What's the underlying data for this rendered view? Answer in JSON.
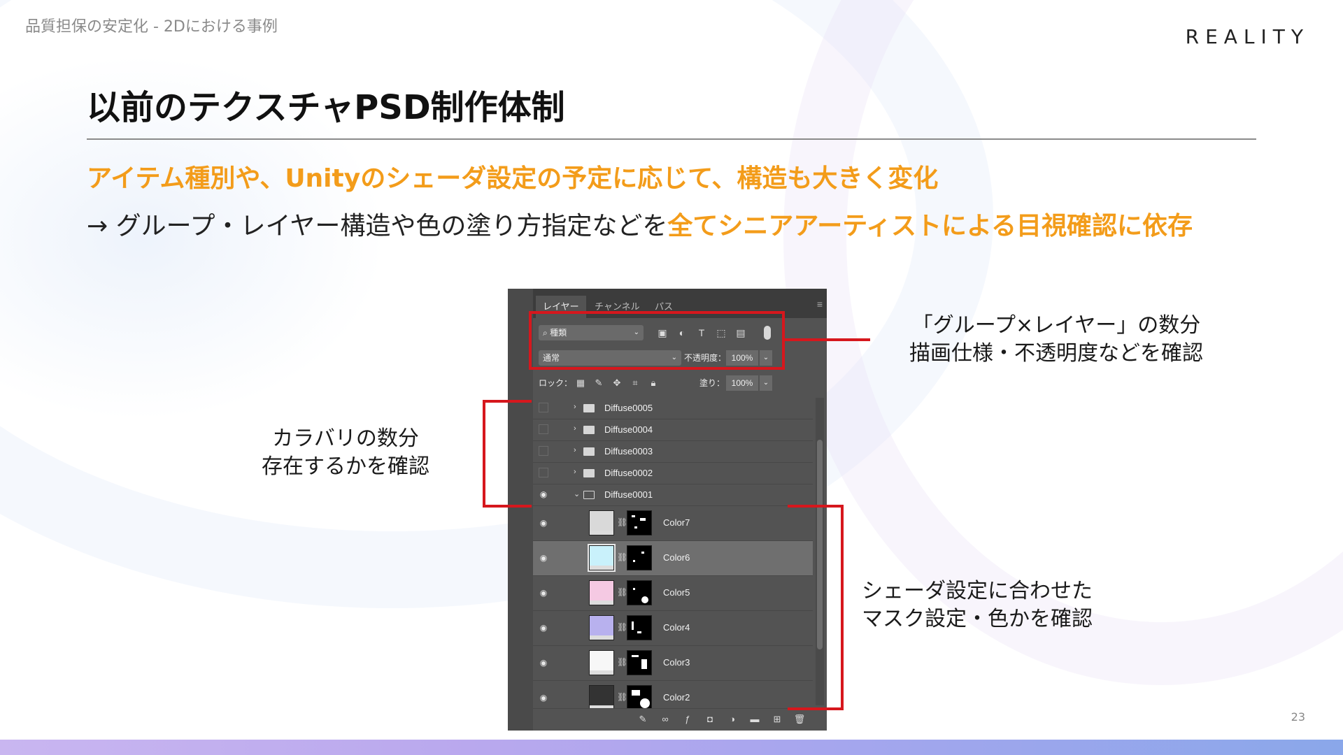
{
  "header": {
    "topic": "品質担保の安定化 - 2Dにおける事例",
    "logo": "REALITY"
  },
  "slide": {
    "title": "以前のテクスチャPSD制作体制",
    "line1": "アイテム種別や、Unityのシェーダ設定の予定に応じて、構造も大きく変化",
    "line2_prefix": "→ グループ・レイヤー構造や色の塗り方指定などを",
    "line2_highlight": "全てシニアアーティストによる目視確認に依存",
    "page_number": "23"
  },
  "annotations": {
    "top_right": [
      "「グループ×レイヤー」の数分",
      "描画仕様・不透明度などを確認"
    ],
    "left": [
      "カラバリの数分",
      "存在するかを確認"
    ],
    "bottom_right": [
      "シェーダ設定に合わせた",
      "マスク設定・色かを確認"
    ]
  },
  "panel": {
    "tabs": [
      "レイヤー",
      "チャンネル",
      "パス"
    ],
    "active_tab": "レイヤー",
    "filter_kind": "種類",
    "blend_mode": "通常",
    "opacity_label": "不透明度：",
    "opacity_value": "100%",
    "lock_label": "ロック：",
    "fill_label": "塗り：",
    "fill_value": "100%",
    "groups": [
      {
        "name": "Diffuse0005",
        "visible": false,
        "expanded": false
      },
      {
        "name": "Diffuse0004",
        "visible": false,
        "expanded": false
      },
      {
        "name": "Diffuse0003",
        "visible": false,
        "expanded": false
      },
      {
        "name": "Diffuse0002",
        "visible": false,
        "expanded": false
      },
      {
        "name": "Diffuse0001",
        "visible": true,
        "expanded": true
      }
    ],
    "layers": [
      {
        "name": "Color7",
        "color": "#d9d9d9",
        "selected": false
      },
      {
        "name": "Color6",
        "color": "#c9f1fb",
        "selected": true
      },
      {
        "name": "Color5",
        "color": "#f5c9e3",
        "selected": false
      },
      {
        "name": "Color4",
        "color": "#b8b1ee",
        "selected": false
      },
      {
        "name": "Color3",
        "color": "#f7f7f7",
        "selected": false
      },
      {
        "name": "Color2",
        "color": "#333333",
        "selected": false
      }
    ],
    "bottom_icons": [
      "brush-icon",
      "link-icon",
      "fx-icon",
      "mask-icon",
      "adjustment-icon",
      "folder-icon",
      "new-layer-icon",
      "trash-icon"
    ]
  },
  "colors": {
    "accent": "#f39c1a",
    "annotation_red": "#d6171d"
  }
}
